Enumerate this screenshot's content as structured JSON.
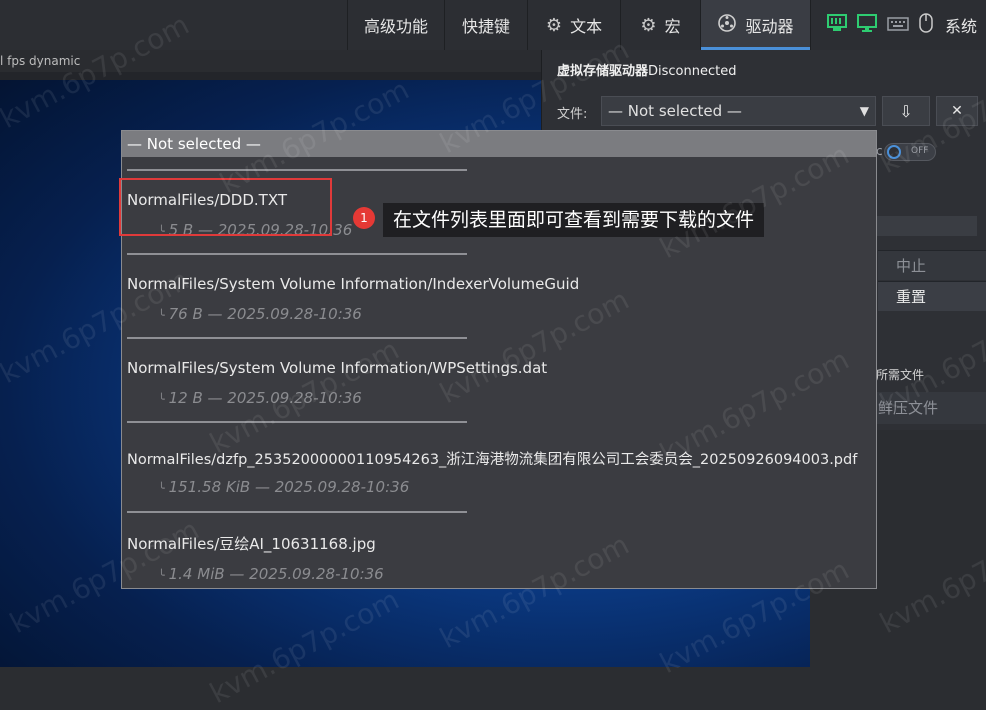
{
  "menu": {
    "advanced": "高级功能",
    "shortcut": "快捷键",
    "text": "文本",
    "macro": "宏",
    "driver": "驱动器",
    "system": "系统"
  },
  "screen": {
    "header": "l fps dynamic"
  },
  "panel": {
    "title_bold": "虚拟存储驱动器",
    "title_status": "Disconnected",
    "file_label": "文件:",
    "file_select_value": "— Not selected —",
    "toggle_colon": "c",
    "toggle_text": "OFF",
    "stop": "中止",
    "reset": "重置",
    "need_file": "所需文件",
    "extract_file": "鲜压文件"
  },
  "popup": {
    "header": "— Not selected —",
    "files": [
      {
        "name": "NormalFiles/DDD.TXT",
        "meta": "5 B — 2025.09.28-10:36"
      },
      {
        "name": "NormalFiles/System Volume Information/IndexerVolumeGuid",
        "meta": "76 B — 2025.09.28-10:36"
      },
      {
        "name": "NormalFiles/System Volume Information/WPSettings.dat",
        "meta": "12 B — 2025.09.28-10:36"
      },
      {
        "name": "NormalFiles/dzfp_25352000000110954263_浙江海港物流集团有限公司工会委员会_20250926094003.pdf",
        "meta": "151.58 KiB — 2025.09.28-10:36"
      },
      {
        "name": "NormalFiles/豆绘AI_10631168.jpg",
        "meta": "1.4 MiB — 2025.09.28-10:36"
      }
    ]
  },
  "annotation": {
    "badge": "1",
    "callout": "在文件列表里面即可查看到需要下载的文件"
  },
  "watermark": "kvm.6p7p.com",
  "icons": {
    "text": "gear-icon",
    "macro": "gear-icon",
    "driver": "drive-icon",
    "network": "network-icon",
    "monitor": "monitor-icon",
    "keyboard": "keyboard-icon",
    "mouse": "mouse-icon",
    "download": "download-icon",
    "close": "close-icon"
  },
  "colors": {
    "accent": "#4a90d9",
    "highlight": "#e03a3a",
    "status_green": "#2ecc71"
  }
}
